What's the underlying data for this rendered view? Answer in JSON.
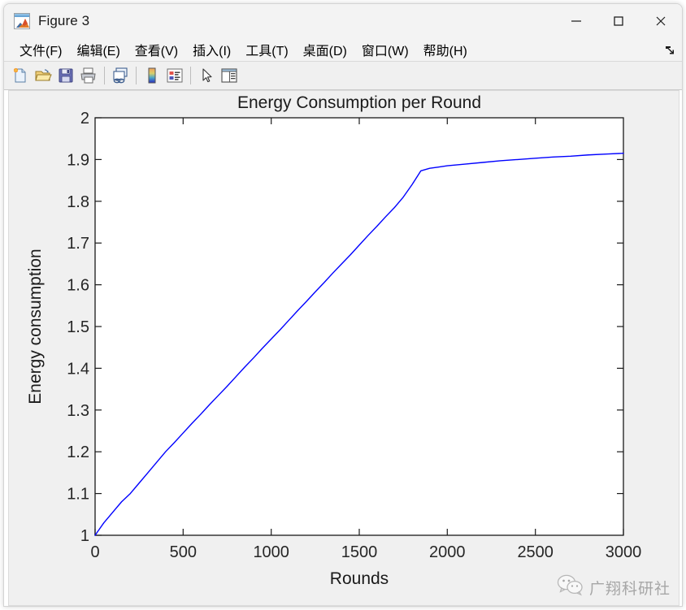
{
  "window": {
    "title": "Figure 3",
    "app_icon": "matlab-figure-icon",
    "controls": {
      "minimize": "minimize-button",
      "maximize": "maximize-button",
      "close": "close-button"
    }
  },
  "menubar": {
    "items": [
      {
        "label": "文件(F)",
        "name": "file"
      },
      {
        "label": "编辑(E)",
        "name": "edit"
      },
      {
        "label": "查看(V)",
        "name": "view"
      },
      {
        "label": "插入(I)",
        "name": "insert"
      },
      {
        "label": "工具(T)",
        "name": "tools"
      },
      {
        "label": "桌面(D)",
        "name": "desktop"
      },
      {
        "label": "窗口(W)",
        "name": "window"
      },
      {
        "label": "帮助(H)",
        "name": "help"
      }
    ],
    "dock_icon": "dock-arrow-icon"
  },
  "toolbar": {
    "buttons": [
      {
        "name": "new-figure-icon",
        "title": "New Figure"
      },
      {
        "name": "open-file-icon",
        "title": "Open File"
      },
      {
        "name": "save-figure-icon",
        "title": "Save Figure"
      },
      {
        "name": "print-figure-icon",
        "title": "Print Figure"
      },
      {
        "name": "link-plot-icon",
        "title": "Link Plot"
      },
      {
        "name": "colorbar-icon",
        "title": "Insert Colorbar"
      },
      {
        "name": "legend-icon",
        "title": "Insert Legend"
      },
      {
        "name": "pointer-arrow-icon",
        "title": "Edit Plot"
      },
      {
        "name": "plot-browser-icon",
        "title": "Show Plot Tools"
      }
    ]
  },
  "chart_data": {
    "type": "line",
    "title": "Energy Consumption per Round",
    "xlabel": "Rounds",
    "ylabel": "Energy consumption",
    "xlim": [
      0,
      3000
    ],
    "ylim": [
      1,
      2
    ],
    "xticks": [
      0,
      500,
      1000,
      1500,
      2000,
      2500,
      3000
    ],
    "xticklabels": [
      "0",
      "500",
      "1000",
      "1500",
      "2000",
      "2500",
      "3000"
    ],
    "yticks": [
      1,
      1.1,
      1.2,
      1.3,
      1.4,
      1.5,
      1.6,
      1.7,
      1.8,
      1.9,
      2
    ],
    "yticklabels": [
      "1",
      "1.1",
      "1.2",
      "1.3",
      "1.4",
      "1.5",
      "1.6",
      "1.7",
      "1.8",
      "1.9",
      "2"
    ],
    "grid": false,
    "legend": null,
    "series": [
      {
        "name": "Energy consumption",
        "color": "#0000ff",
        "line_width": 1,
        "x": [
          0,
          50,
          100,
          150,
          200,
          250,
          300,
          350,
          400,
          450,
          500,
          550,
          600,
          650,
          700,
          750,
          800,
          850,
          900,
          950,
          1000,
          1050,
          1100,
          1150,
          1200,
          1250,
          1300,
          1350,
          1400,
          1450,
          1500,
          1550,
          1600,
          1650,
          1700,
          1750,
          1800,
          1850,
          1900,
          1950,
          2000,
          2100,
          2200,
          2300,
          2400,
          2500,
          2600,
          2700,
          2800,
          2900,
          3000
        ],
        "y": [
          1.0,
          1.03,
          1.055,
          1.08,
          1.1,
          1.125,
          1.15,
          1.175,
          1.2,
          1.222,
          1.245,
          1.268,
          1.29,
          1.313,
          1.335,
          1.357,
          1.38,
          1.403,
          1.425,
          1.448,
          1.47,
          1.492,
          1.515,
          1.538,
          1.56,
          1.583,
          1.605,
          1.628,
          1.65,
          1.672,
          1.695,
          1.718,
          1.74,
          1.763,
          1.785,
          1.81,
          1.84,
          1.873,
          1.879,
          1.882,
          1.885,
          1.889,
          1.893,
          1.897,
          1.9,
          1.903,
          1.906,
          1.908,
          1.911,
          1.913,
          1.915
        ]
      }
    ]
  },
  "watermark": {
    "text": "广翔科研社",
    "icon": "wechat-icon"
  }
}
